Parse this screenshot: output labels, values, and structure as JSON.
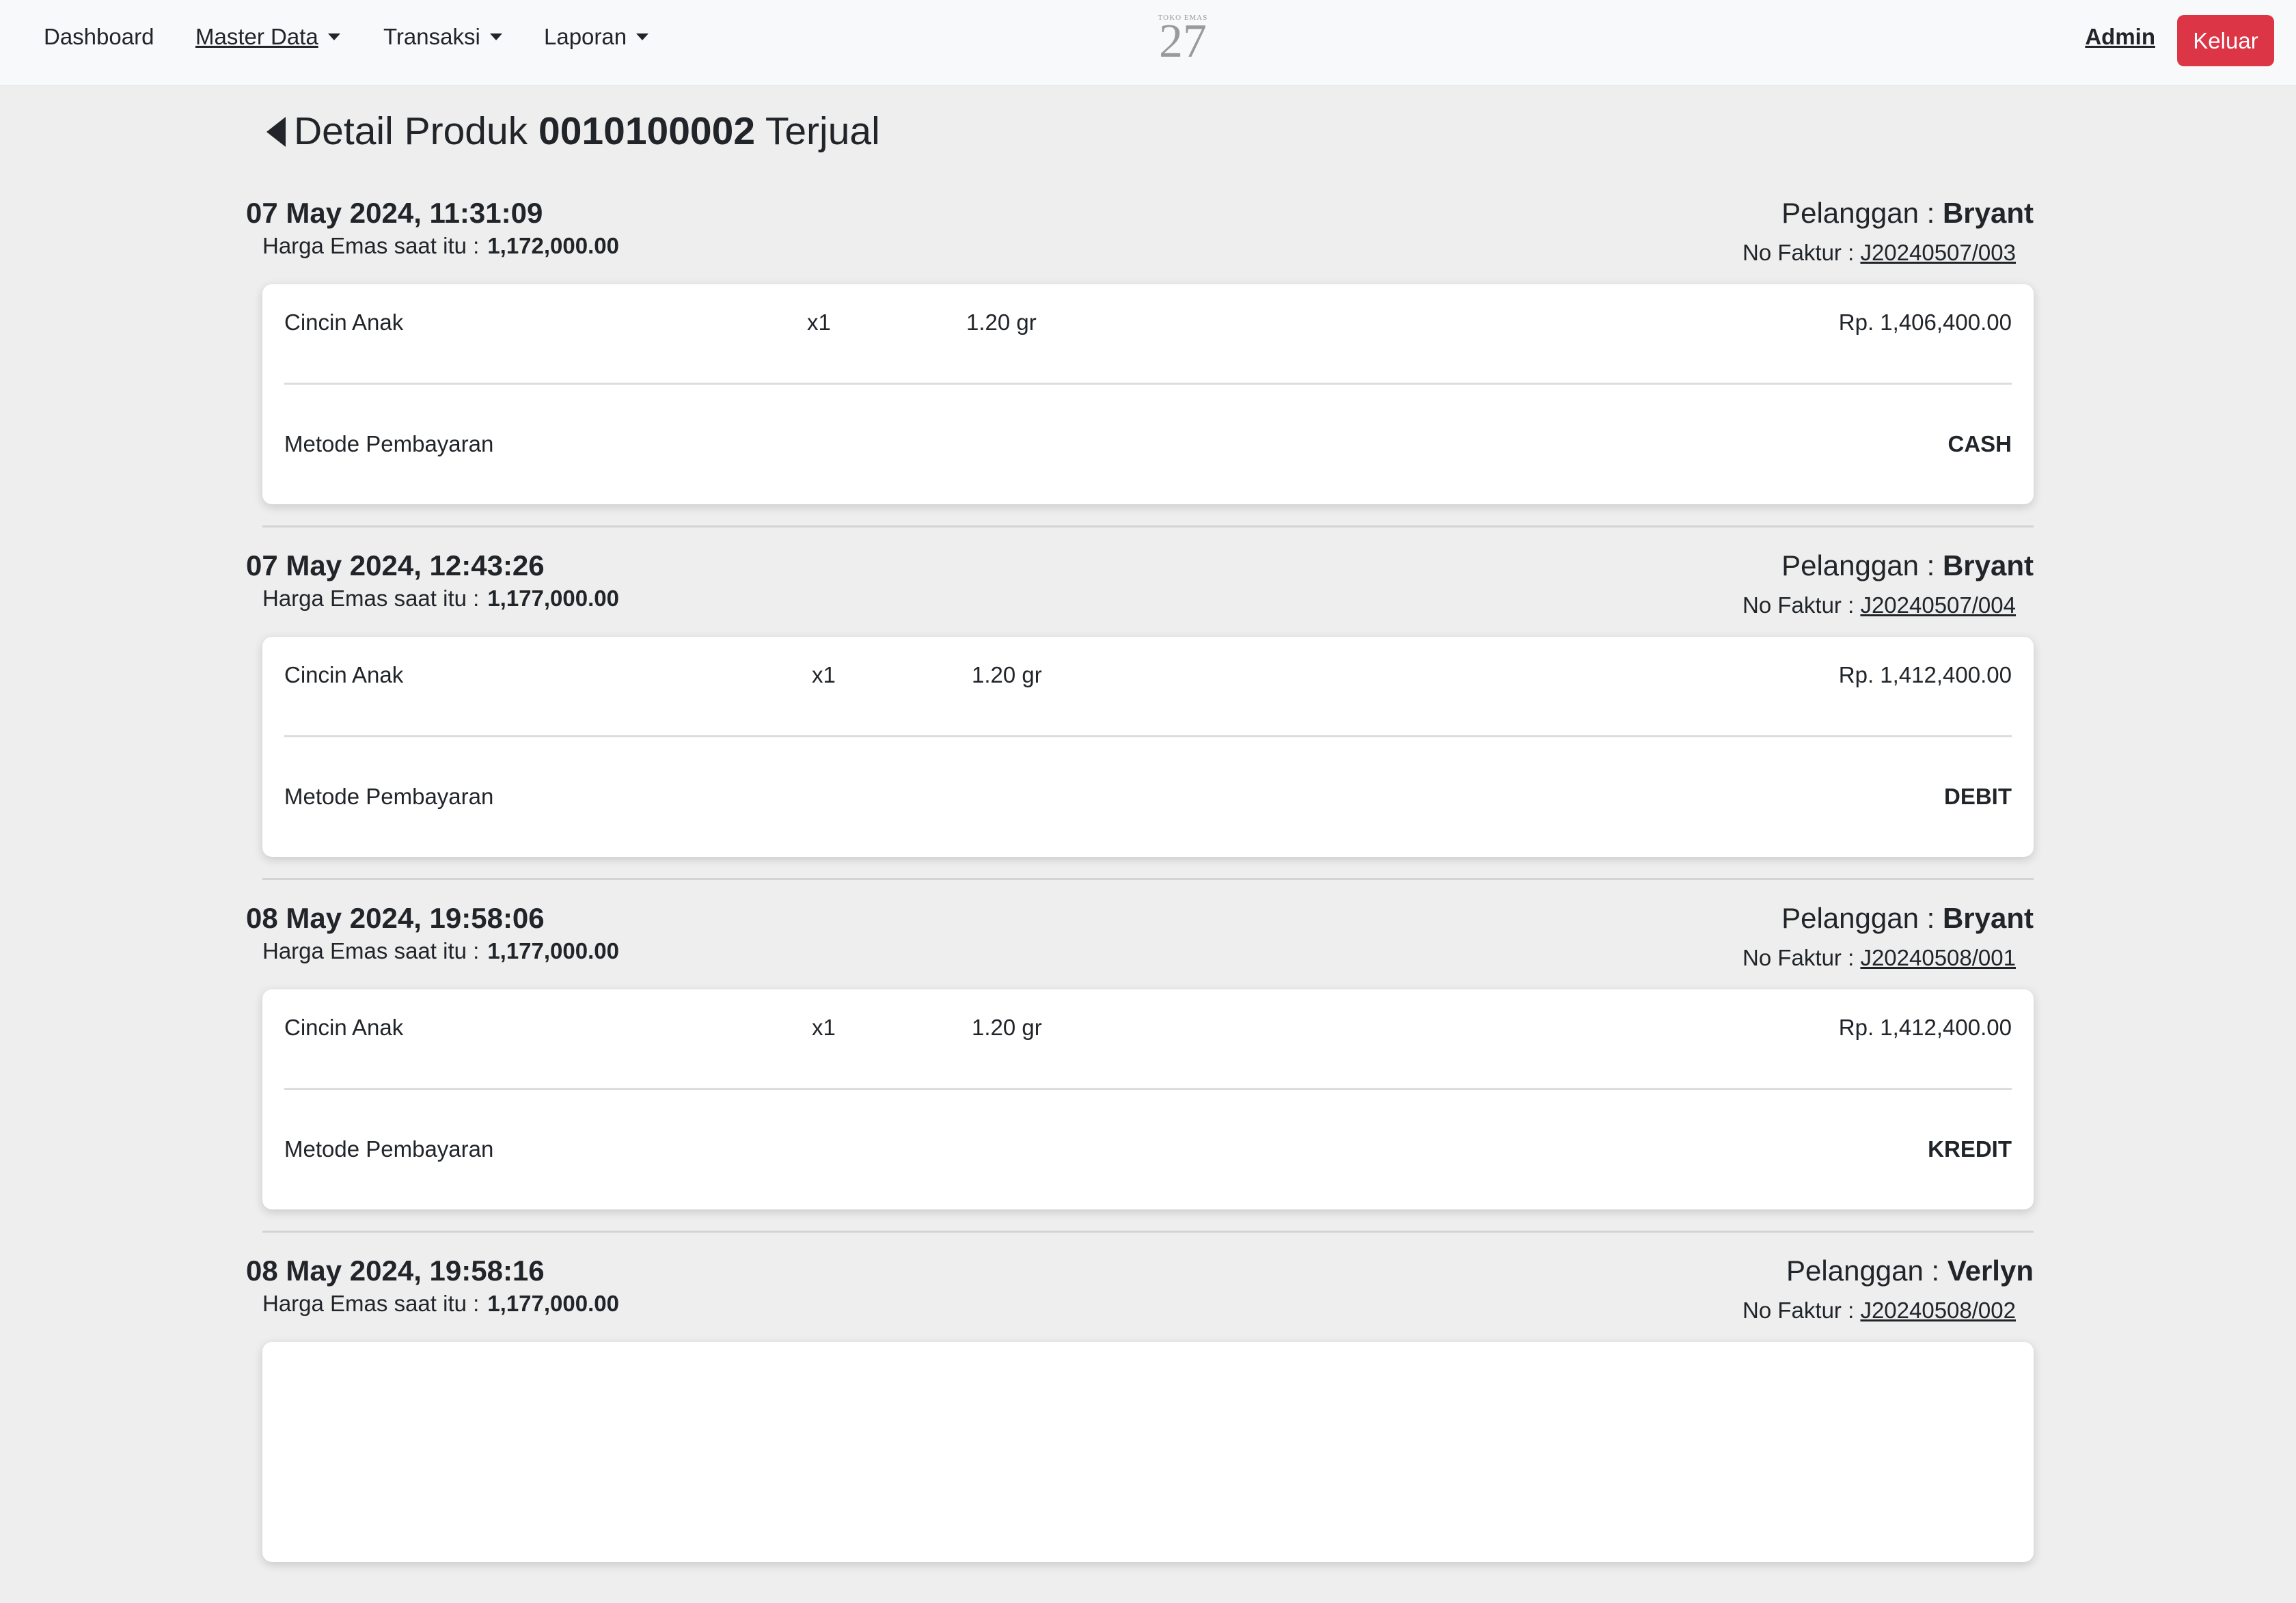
{
  "nav": {
    "dashboard": "Dashboard",
    "master_data": "Master Data",
    "transaksi": "Transaksi",
    "laporan": "Laporan",
    "logo_top": "TOKO EMAS",
    "logo_number": "27",
    "admin": "Admin",
    "logout": "Keluar"
  },
  "page": {
    "title_prefix": "Detail Produk",
    "product_code": "0010100002",
    "title_suffix": "Terjual"
  },
  "labels": {
    "gold_price": "Harga Emas saat itu :",
    "customer": "Pelanggan :",
    "invoice": "No Faktur :",
    "payment_method": "Metode Pembayaran"
  },
  "colors": {
    "logout_button": "#dc3545",
    "navbar_bg": "#f8f9fa",
    "page_bg": "#eeeeee"
  },
  "transactions": [
    {
      "datetime": "07 May 2024, 11:31:09",
      "gold_price": "1,172,000.00",
      "customer": "Bryant",
      "invoice": "J20240507/003",
      "item_name": "Cincin Anak",
      "qty": "x1",
      "weight": "1.20 gr",
      "price": "Rp. 1,406,400.00",
      "payment_method": "CASH"
    },
    {
      "datetime": "07 May 2024, 12:43:26",
      "gold_price": "1,177,000.00",
      "customer": "Bryant",
      "invoice": "J20240507/004",
      "item_name": "Cincin Anak",
      "qty": "x1",
      "weight": "1.20 gr",
      "price": "Rp. 1,412,400.00",
      "payment_method": "DEBIT"
    },
    {
      "datetime": "08 May 2024, 19:58:06",
      "gold_price": "1,177,000.00",
      "customer": "Bryant",
      "invoice": "J20240508/001",
      "item_name": "Cincin Anak",
      "qty": "x1",
      "weight": "1.20 gr",
      "price": "Rp. 1,412,400.00",
      "payment_method": "KREDIT"
    },
    {
      "datetime": "08 May 2024, 19:58:16",
      "gold_price": "1,177,000.00",
      "customer": "Verlyn",
      "invoice": "J20240508/002",
      "item_name": "",
      "qty": "",
      "weight": "",
      "price": "",
      "payment_method": ""
    }
  ]
}
